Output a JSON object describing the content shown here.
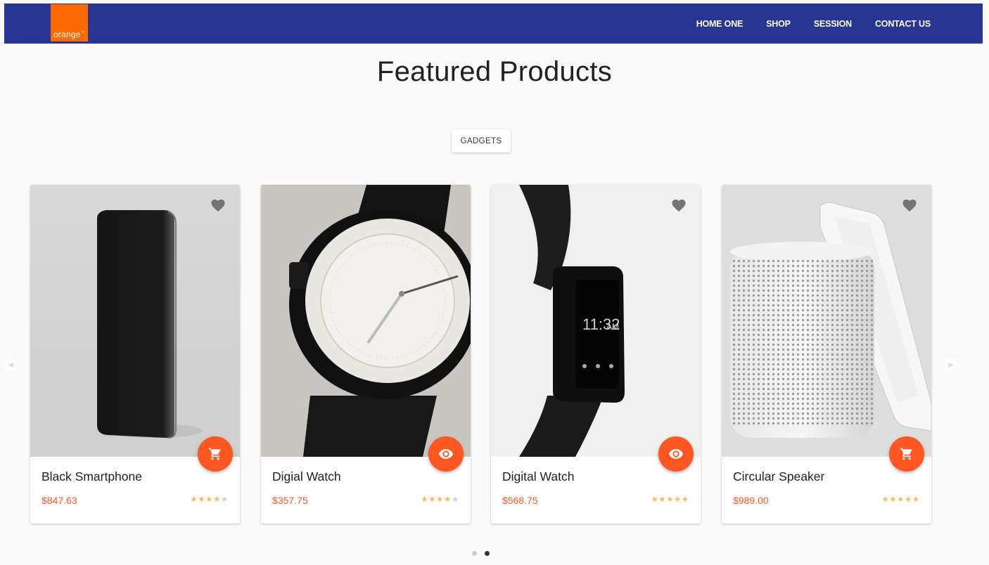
{
  "brand": {
    "logo_text": "orange",
    "logo_mark": "™"
  },
  "nav": {
    "links": [
      "HOME ONE",
      "SHOP",
      "SESSION",
      "CONTACT US"
    ]
  },
  "section": {
    "title": "Featured Products",
    "filter_label": "GADGETS"
  },
  "colors": {
    "navbar": "#283593",
    "logo": "#ff6a00",
    "accent": "#ff5722",
    "star": "#ffb74d"
  },
  "products": [
    {
      "name": "Black Smartphone",
      "price": "$847.63",
      "rating": 4,
      "action_icon": "cart-icon"
    },
    {
      "name": "Digial Watch",
      "price": "$357.75",
      "rating": 4,
      "action_icon": "eye-icon"
    },
    {
      "name": "Digital Watch",
      "price": "$568.75",
      "rating": 5,
      "action_icon": "eye-icon"
    },
    {
      "name": "Circular Speaker",
      "price": "$989.00",
      "rating": 5,
      "action_icon": "cart-icon"
    }
  ],
  "carousel": {
    "pages": 2,
    "active_page": 2
  },
  "icons": {
    "favorite": "heart-icon",
    "prev": "chevron-left-icon",
    "next": "chevron-right-icon"
  }
}
